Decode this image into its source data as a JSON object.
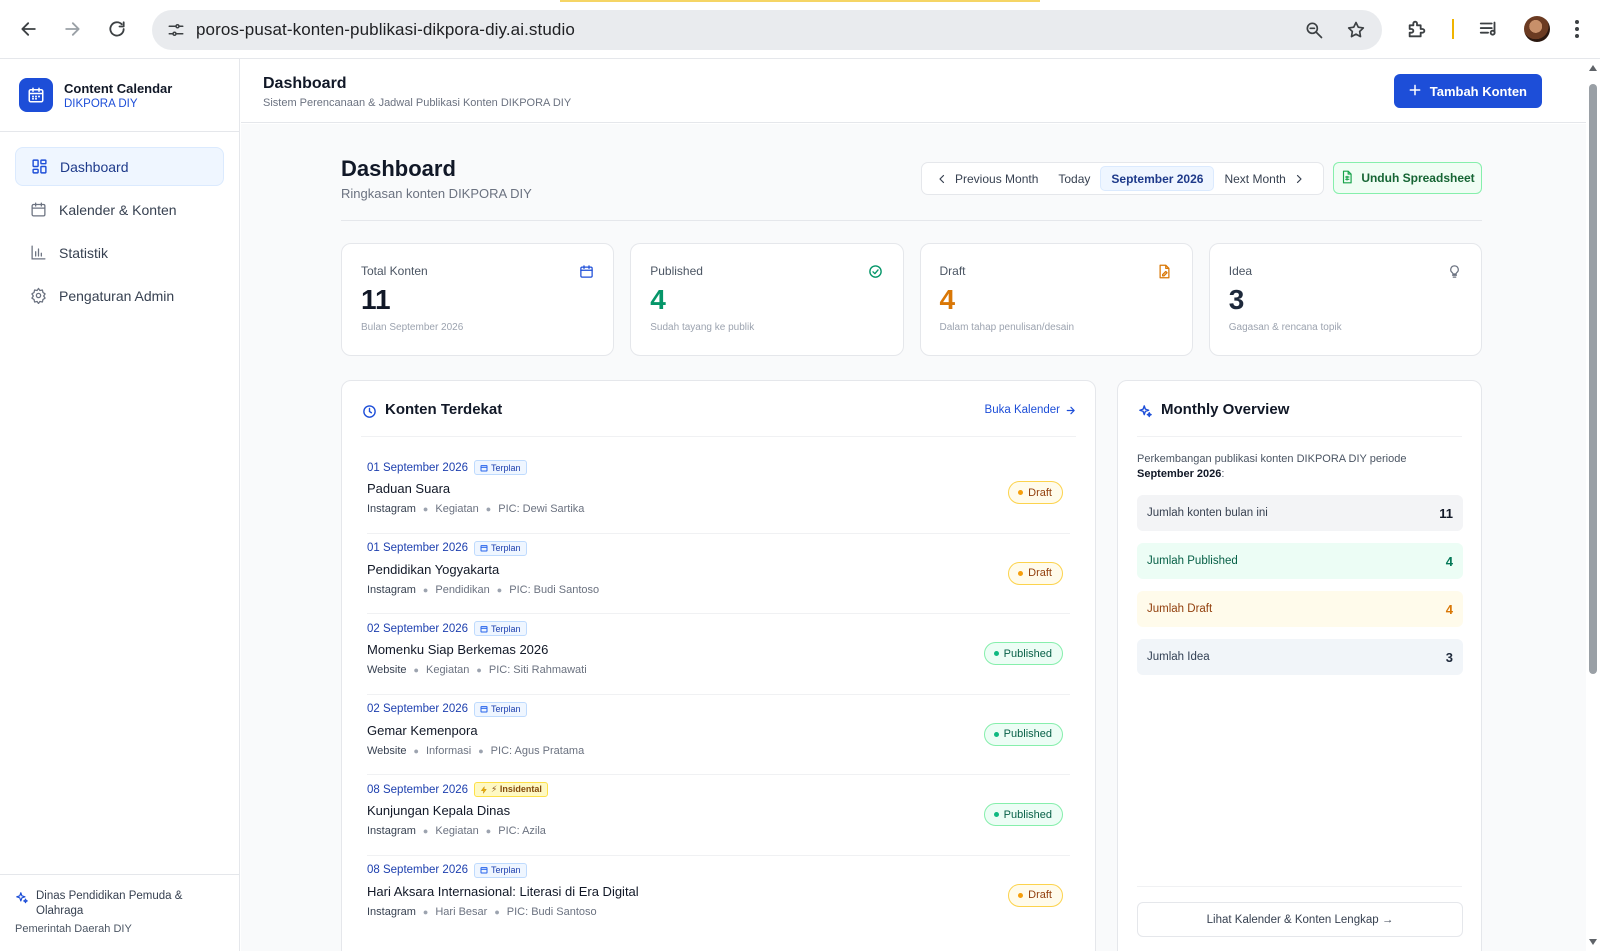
{
  "browser": {
    "url": "poros-pusat-konten-publikasi-dikpora-diy.ai.studio"
  },
  "sidebar": {
    "brand_title": "Content Calendar",
    "brand_sub": "DIKPORA DIY",
    "items": [
      {
        "label": "Dashboard",
        "icon": "dashboard-icon",
        "active": true
      },
      {
        "label": "Kalender & Konten",
        "icon": "calendar-icon",
        "active": false
      },
      {
        "label": "Statistik",
        "icon": "bar-chart-icon",
        "active": false
      },
      {
        "label": "Pengaturan Admin",
        "icon": "gear-icon",
        "active": false
      }
    ],
    "footer_org": "Dinas Pendidikan Pemuda & Olahraga",
    "footer_gov": "Pemerintah Daerah DIY"
  },
  "topbar": {
    "title": "Dashboard",
    "subtitle": "Sistem Perencanaan & Jadwal Publikasi Konten DIKPORA DIY",
    "add_button": "Tambah Konten"
  },
  "page": {
    "title": "Dashboard",
    "subtitle": "Ringkasan konten DIKPORA DIY",
    "nav": {
      "prev": "Previous Month",
      "today": "Today",
      "current": "September 2026",
      "next": "Next Month"
    },
    "download_button": "Unduh Spreadsheet"
  },
  "stats": [
    {
      "label": "Total Konten",
      "value": "11",
      "hint": "Bulan September 2026",
      "icon": "calendar-icon",
      "color": "#111827",
      "icon_color": "#1d4ed8"
    },
    {
      "label": "Published",
      "value": "4",
      "hint": "Sudah tayang ke publik",
      "icon": "check-circle-icon",
      "color": "#059669",
      "icon_color": "#059669"
    },
    {
      "label": "Draft",
      "value": "4",
      "hint": "Dalam tahap penulisan/desain",
      "icon": "file-edit-icon",
      "color": "#d97706",
      "icon_color": "#d97706"
    },
    {
      "label": "Idea",
      "value": "3",
      "hint": "Gagasan & rencana topik",
      "icon": "lightbulb-icon",
      "color": "#1e293b",
      "icon_color": "#6b7280"
    }
  ],
  "upcoming": {
    "title": "Konten Terdekat",
    "link": "Buka Kalender",
    "items": [
      {
        "date": "01 September 2026",
        "tag": "Terplan",
        "tag_type": "terplan",
        "title": "Paduan Suara",
        "channel": "Instagram",
        "category": "Kegiatan",
        "pic": "PIC: Dewi Sartika",
        "status": "Draft",
        "status_type": "draft"
      },
      {
        "date": "01 September 2026",
        "tag": "Terplan",
        "tag_type": "terplan",
        "title": "Pendidikan Yogyakarta",
        "channel": "Instagram",
        "category": "Pendidikan",
        "pic": "PIC: Budi Santoso",
        "status": "Draft",
        "status_type": "draft"
      },
      {
        "date": "02 September 2026",
        "tag": "Terplan",
        "tag_type": "terplan",
        "title": "Momenku Siap Berkemas 2026",
        "channel": "Website",
        "category": "Kegiatan",
        "pic": "PIC: Siti Rahmawati",
        "status": "Published",
        "status_type": "published"
      },
      {
        "date": "02 September 2026",
        "tag": "Terplan",
        "tag_type": "terplan",
        "title": "Gemar Kemenpora",
        "channel": "Website",
        "category": "Informasi",
        "pic": "PIC: Agus Pratama",
        "status": "Published",
        "status_type": "published"
      },
      {
        "date": "08 September 2026",
        "tag": "⚡ Insidental",
        "tag_type": "insidental",
        "title": "Kunjungan Kepala Dinas",
        "channel": "Instagram",
        "category": "Kegiatan",
        "pic": "PIC: Azila",
        "status": "Published",
        "status_type": "published"
      },
      {
        "date": "08 September 2026",
        "tag": "Terplan",
        "tag_type": "terplan",
        "title": "Hari Aksara Internasional: Literasi di Era Digital",
        "channel": "Instagram",
        "category": "Hari Besar",
        "pic": "PIC: Budi Santoso",
        "status": "Draft",
        "status_type": "draft"
      }
    ]
  },
  "overview": {
    "title": "Monthly Overview",
    "intro": "Perkembangan publikasi konten DIKPORA DIY periode",
    "period": "September 2026",
    "period_suffix": ":",
    "rows": [
      {
        "label": "Jumlah konten bulan ini",
        "value": "11",
        "type": "total"
      },
      {
        "label": "Jumlah Published",
        "value": "4",
        "type": "pub"
      },
      {
        "label": "Jumlah Draft",
        "value": "4",
        "type": "draft"
      },
      {
        "label": "Jumlah Idea",
        "value": "3",
        "type": "idea"
      }
    ],
    "button": "Lihat Kalender & Konten Lengkap →"
  }
}
